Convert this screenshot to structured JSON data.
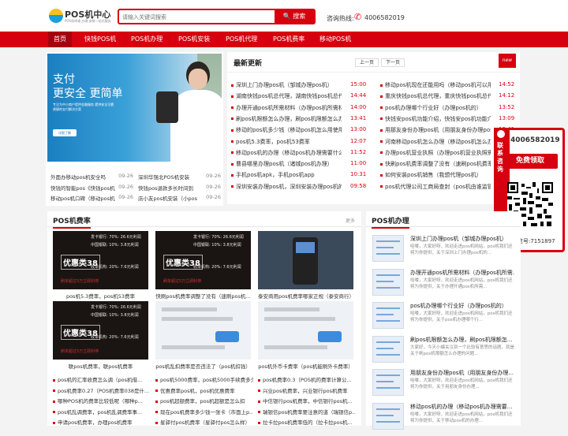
{
  "header": {
    "logo_title": "POS机中心",
    "logo_sub": "POS机申请 办理 安装一站式服务",
    "search_placeholder": "请输入关键词搜索",
    "search_btn": "搜索",
    "hotline_label": "咨询热线:",
    "hotline": "4006582019"
  },
  "nav": [
    "首页",
    "快钱POS机",
    "POS机办理",
    "POS机安装",
    "POS机代理",
    "POS机费率",
    "移动POS机"
  ],
  "banner": {
    "line1": "支付",
    "line2": "更安全 更简单",
    "sub": "专注为中小商户提供金融服务 提供安全可靠便捷的支付解决方案",
    "btn": "详细了解"
  },
  "left_news": [
    {
      "t": "外面办移动pos机安全吗",
      "d": "09-26"
    },
    {
      "t": "深圳华强北POS机安装",
      "d": "09-26"
    },
    {
      "t": "快钱的智能pos《快钱pos机",
      "d": "09-26"
    },
    {
      "t": "快钱pos退款多长时间到",
      "d": "09-26"
    },
    {
      "t": "移动pos机口碑（移动pos机",
      "d": "09-26"
    },
    {
      "t": "店小友pos机安装（小pos",
      "d": "09-26"
    }
  ],
  "latest": {
    "title": "最新更新",
    "prev": "上一页",
    "next": "下一页",
    "new_tag": "new",
    "col1": [
      {
        "t": "深圳上门办理pos机（邹城办理pos机）",
        "d": "15:00"
      },
      {
        "t": "湖南快钱pos机总代理，湖南快钱pos机总代理电话",
        "d": "14:44"
      },
      {
        "t": "办理开通pos机所需材料（办理pos机所需材料）",
        "d": "14:00"
      },
      {
        "t": "刷pos机限额怎么办理，刷pos机限额怎么办理的",
        "d": "13:41"
      },
      {
        "t": "移动的pos机多少钱（移动pos机怎么用使用）",
        "d": "13:00"
      },
      {
        "t": "pos机5.3费率，pos机53费率",
        "d": "12:07"
      },
      {
        "t": "移动pos机的办理（移动pos机办理需要什么）",
        "d": "11:52"
      },
      {
        "t": "曹县哪里办理pos机（诸城pos机办理）",
        "d": "11:00"
      },
      {
        "t": "手机pos机apk，手机pos机app",
        "d": "10:31"
      },
      {
        "t": "深圳安装办理pos机，深圳安装办理pos机的地方",
        "d": "09:58"
      }
    ],
    "col2": [
      {
        "t": "移动pos机现在还能用吗（移动pos机可以用吗）",
        "d": "14:52"
      },
      {
        "t": "重庆快钱pos机总代理，重庆快钱pos机总代理电话",
        "d": "14:12"
      },
      {
        "t": "pos机办理哪个行业好（办理pos机的）",
        "d": "13:52"
      },
      {
        "t": "快钱安pos机功能介绍，快钱安pos机功能介绍图",
        "d": "13:09"
      },
      {
        "t": "用那友身份办理pos机（用朋友身份办理pos机）",
        "d": "12:41"
      },
      {
        "t": "河南移动pos机怎么办理（移动pos机怎么办理）",
        "d": "12:00"
      },
      {
        "t": "办理pos机营业执照（办理pos机营业执照需要）",
        "d": "11:38"
      },
      {
        "t": "快刷pos机费率调整了没有（速刷pos机费率多少）",
        "d": "10:46"
      },
      {
        "t": "如何安装pos机销售（我想代理pos机）",
        "d": "10:12"
      },
      {
        "t": "pos机代理公司工商局查封（pos机由谁监管）",
        "d": "09:45"
      }
    ]
  },
  "float": {
    "side_label": "联系咨询",
    "phone": "4006582019",
    "btn": "免费领取",
    "wechat": "微信号:7151897"
  },
  "fee": {
    "title": "POS机费率",
    "more": "更多",
    "thumb_text": {
      "a": "发卡银行: 70%: 26.6元利润",
      "b": "中国银联: 10%: 3.8元利润",
      "big": "优惠类38",
      "c": "收单机构: 20%: 7.6元利润",
      "d": "刷单超过5万立即封停"
    },
    "caps": [
      "pos机5.3费率，pos机53费率",
      "快刷pos机费率调整了没有（速刷pos机...",
      "泰安商用pos机费率哪家正规（泰安商行）",
      "联pos机费率，联pos机费率",
      "pos机乱扣费率是否违法了（pos机扣钱）",
      "pos机外币卡费率（pos机能刷外卡费率）"
    ],
    "list": [
      {
        "c1": "pos机的汇率收费怎么调（pos机借...",
        "c2": "pos机5000费率，pos机5000手续费多少",
        "c3": "pos机费率0.3（POS机的费率计算公..."
      },
      {
        "c1": "pos机费率0.27（POS机费率038是什...",
        "c2": "优惠费率pos机，pos机优惠费率",
        "c3": "兴业pos机费率，兴业银行pos机费率"
      },
      {
        "c1": "哪种POS机的费率比较低呢（哪种p...",
        "c2": "pos机超额费率，pos机超额是怎么扣",
        "c3": "中信银行pos机费率，中信银行pos机..."
      },
      {
        "c1": "pos机乱调费率，pos机乱调费率事...",
        "c2": "现在pos机费率多少钱一张卡（市面上p...",
        "c3": "瑞银信pos机费率要注意的道（瑞银信p..."
      },
      {
        "c1": "申请pos机费率，办理pos机费率",
        "c2": "星驿付pos机费率（星驿付pos怎么样）",
        "c3": "拉卡拉pos机费率低的（拉卡拉pos机..."
      }
    ]
  },
  "handle": {
    "title": "POS机办理",
    "items": [
      {
        "t": "深圳上门办理pos机（邹城办理pos机）",
        "s": "哈喽，大家好呀，欢迎走进pos机网站，pos机我们还将为你提供，关于深圳上门办理pos机的..."
      },
      {
        "t": "办理开通pos机所需材料（办理pos机所需...",
        "s": "哈喽，大家好呀，欢迎走进pos机网站，pos机我们还将为你提供，关于办理开通pos机所需..."
      },
      {
        "t": "pos机办理哪个行业好（办理pos机的）",
        "s": "哈喽，大家好呀，欢迎走进pos机网站，pos机我们还将为你提供，关于pos机办理哪个行..."
      },
      {
        "t": "刷pos机限额怎么办理，刷pos机限额怎...",
        "s": "大家好，今天小编关注到一个比较有意思的话题，就是关于刷pos机限额怎么办理的问题..."
      },
      {
        "t": "用朋友身份办理pos机（用朋友身份办理...",
        "s": "哈喽，大家好呀，欢迎走进pos机网站，pos机我们还将为你提供，关于用朋友身份办理..."
      },
      {
        "t": "移动pos机的办理（移动pos机办理需要...",
        "s": "哈喽，大家好呀，欢迎走进pos机网站，pos机我们还将为你提供，关于移动pos机的办理..."
      }
    ]
  }
}
